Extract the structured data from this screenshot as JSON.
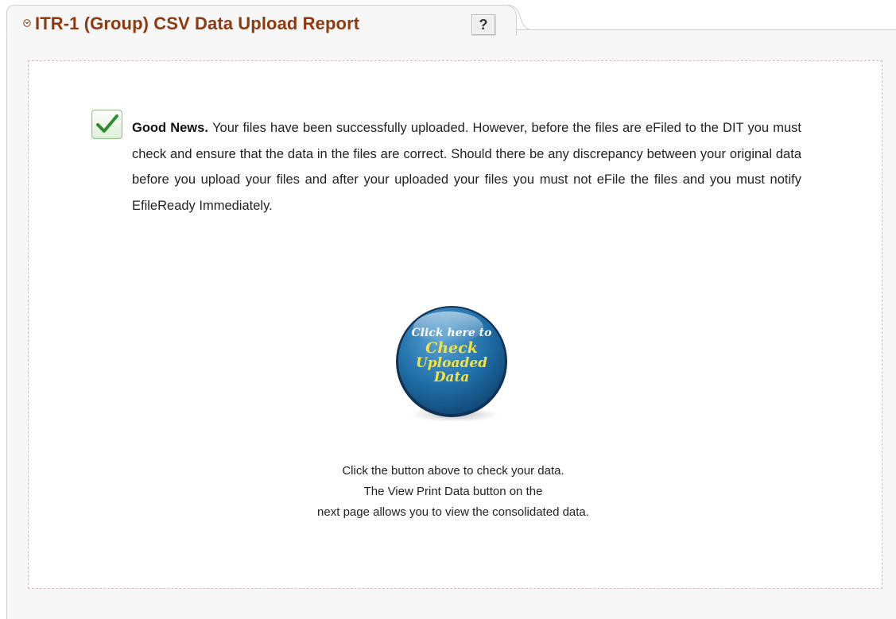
{
  "header": {
    "title": "ITR-1 (Group) CSV Data Upload Report",
    "help_label": "?"
  },
  "message": {
    "lead": "Good News.",
    "body": "Your files have been successfully uploaded. However, before the files are eFiled to the DIT you must check and ensure that the data in the files are correct. Should there be any discrepancy between your original data before you upload your files and after your uploaded your files you must not eFile the files and you must notify EfileReady Immediately."
  },
  "cta": {
    "line1": "Click here to",
    "line2": "Check",
    "line3": "Uploaded",
    "line4": "Data"
  },
  "footer": {
    "line1": "Click the button above to check your data.",
    "line2": "The View Print Data button on the",
    "line3": "next page allows you to view the consolidated data."
  },
  "colors": {
    "title": "#8b3a12",
    "cta_blue": "#1f6ea8",
    "cta_text_yellow": "#f5e33a",
    "check_green": "#2e8b2e"
  },
  "icons": {
    "title_icon": "circle-arrow-icon",
    "check_icon": "checkmark-icon"
  }
}
